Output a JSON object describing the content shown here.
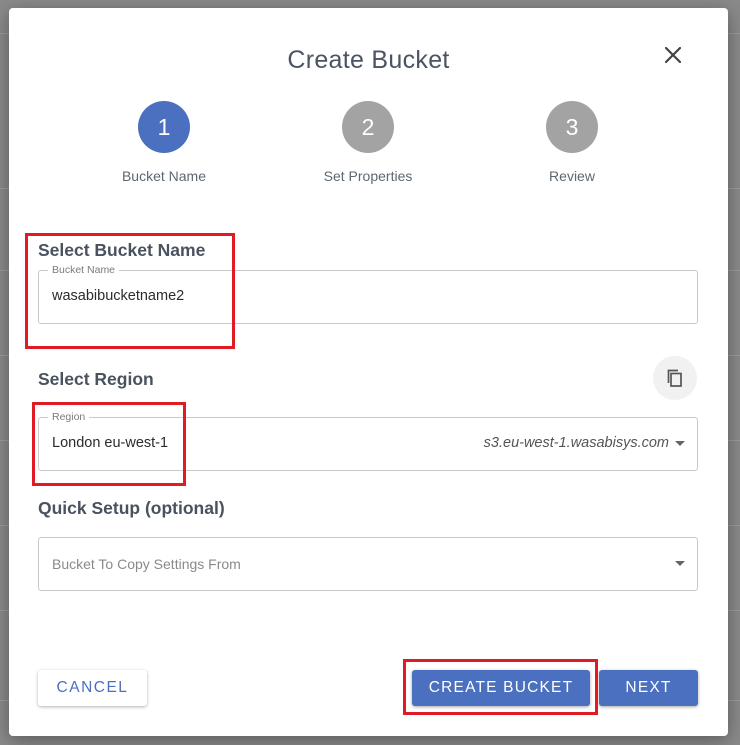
{
  "dialog": {
    "title": "Create Bucket",
    "close_icon": "close-icon"
  },
  "stepper": {
    "steps": [
      {
        "number": "1",
        "label": "Bucket Name",
        "state": "active"
      },
      {
        "number": "2",
        "label": "Set Properties",
        "state": "inactive"
      },
      {
        "number": "3",
        "label": "Review",
        "state": "inactive"
      }
    ]
  },
  "bucket_name": {
    "section_label": "Select Bucket Name",
    "field_label": "Bucket Name",
    "value": "wasabibucketname2"
  },
  "region": {
    "section_label": "Select Region",
    "field_label": "Region",
    "value": "London eu-west-1",
    "endpoint": "s3.eu-west-1.wasabisys.com",
    "copy_icon": "copy-icon"
  },
  "quick_setup": {
    "section_label": "Quick Setup (optional)",
    "placeholder": "Bucket To Copy Settings From"
  },
  "actions": {
    "cancel_label": "CANCEL",
    "create_label": "CREATE BUCKET",
    "next_label": "NEXT"
  },
  "colors": {
    "accent": "#4b70bf",
    "inactive_step": "#a3a3a3",
    "highlight": "#e01b24"
  }
}
